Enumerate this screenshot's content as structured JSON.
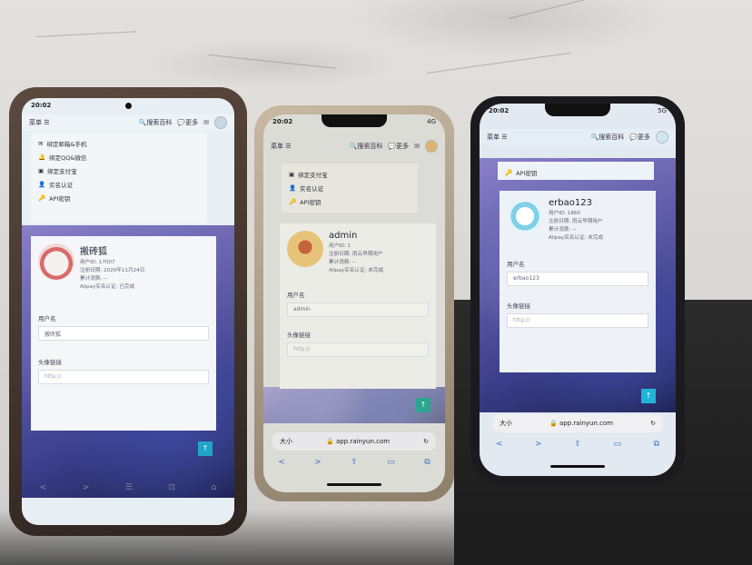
{
  "phones": {
    "left": {
      "status_time": "20:02",
      "topbar": {
        "menu": "菜单 ☰",
        "search": "🔍搜索百科",
        "more": "💬更多",
        "mail": "✉"
      },
      "menu_items": [
        "绑定邮箱&手机",
        "绑定QQ&微信",
        "绑定支付宝",
        "实名认证",
        "API密钥"
      ],
      "profile": {
        "name": "搬砖狐",
        "lines": [
          "用户ID: 17007",
          "注册日期: 2020年11月24日",
          "累计消费: --",
          "Alipay实名认证: 已完成"
        ]
      },
      "username_label": "用户名",
      "username_value": "搬砖狐",
      "avatar_label": "头像链接",
      "avatar_placeholder": "http://",
      "scroll_top": "↑",
      "nav": [
        "<",
        ">",
        "☰",
        "⊡",
        "⌂"
      ]
    },
    "center": {
      "status_time": "20:02",
      "status_right": "4G",
      "topbar": {
        "menu": "菜单 ☰",
        "search": "🔍搜索百科",
        "more": "💬更多",
        "mail": "✉"
      },
      "menu_items": [
        "绑定支付宝",
        "实名认证",
        "API密钥"
      ],
      "profile": {
        "name": "admin",
        "lines": [
          "用户ID: 1",
          "注册日期: 雨云早期用户",
          "累计消费: --",
          "Alipay实名认证: 未完成"
        ]
      },
      "username_label": "用户名",
      "username_value": "admin",
      "avatar_label": "头像链接",
      "avatar_placeholder": "http://",
      "scroll_top": "↑",
      "urlbar": {
        "left": "大小",
        "url": "🔒 app.rainyun.com",
        "right": "↻"
      },
      "toolbar": [
        "<",
        ">",
        "⇧",
        "▭",
        "⧉"
      ]
    },
    "right": {
      "status_time": "20:02",
      "status_right": "5G",
      "topbar": {
        "menu": "菜单 ☰",
        "search": "🔍搜索百科",
        "more": "💬更多",
        "mail": "✉"
      },
      "menu_items": [
        "API密钥"
      ],
      "profile": {
        "name": "erbao123",
        "lines": [
          "用户ID: 1860",
          "注册日期: 雨云早期用户",
          "累计消费: --",
          "Alipay实名认证: 未完成"
        ]
      },
      "username_label": "用户名",
      "username_value": "erbao123",
      "avatar_label": "头像链接",
      "avatar_placeholder": "http://",
      "scroll_top": "↑",
      "urlbar": {
        "left": "大小",
        "url": "🔒 app.rainyun.com",
        "right": "↻"
      },
      "toolbar": [
        "<",
        ">",
        "⇧",
        "▭",
        "⧉"
      ]
    }
  }
}
